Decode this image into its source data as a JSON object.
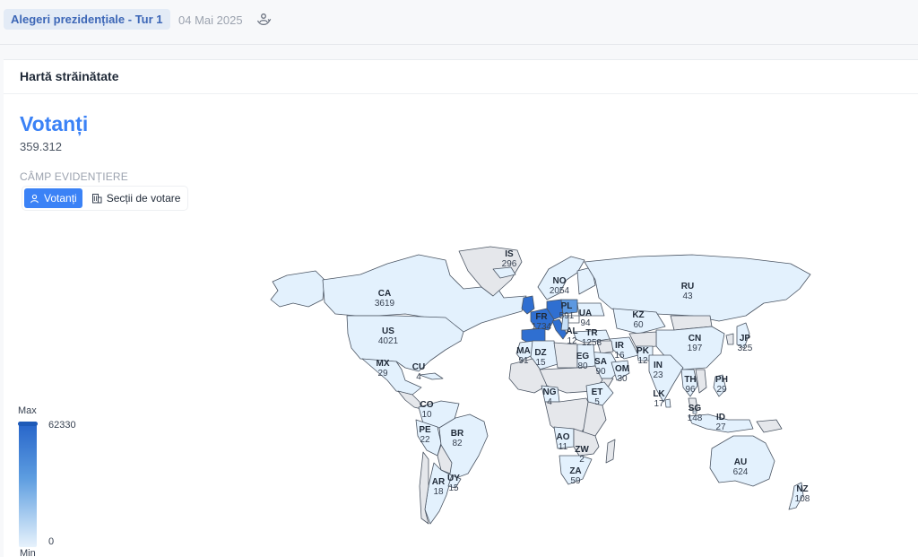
{
  "header": {
    "election": "Alegeri prezidențiale - Tur 1",
    "date": "04 Mai 2025",
    "sync_icon": "sync-people-icon"
  },
  "card": {
    "title": "Hartă străinătate",
    "metric_title": "Votanți",
    "metric_value": "359.312",
    "field_label": "CÂMP EVIDENȚIERE",
    "toggle": {
      "voters_label": "Votanți",
      "voters_icon": "user-icon",
      "stations_label": "Secții de votare",
      "stations_icon": "building-icon",
      "selected": "voters"
    }
  },
  "legend": {
    "max_label": "Max",
    "min_label": "Min",
    "max_value": "62330",
    "min_value": "0",
    "color_max": "#2563c9",
    "color_min": "#e7f2fc"
  },
  "colors": {
    "accent": "#3b82f6",
    "no_data": "#e5e7eb",
    "low": "#e3f1fd"
  },
  "map_labels": [
    {
      "code": "CA",
      "value": "3619"
    },
    {
      "code": "US",
      "value": "4021"
    },
    {
      "code": "MX",
      "value": "29"
    },
    {
      "code": "CU",
      "value": "4"
    },
    {
      "code": "CO",
      "value": "10"
    },
    {
      "code": "PE",
      "value": "22"
    },
    {
      "code": "BR",
      "value": "82"
    },
    {
      "code": "AR",
      "value": "18"
    },
    {
      "code": "UY",
      "value": "15"
    },
    {
      "code": "IS",
      "value": "296"
    },
    {
      "code": "NO",
      "value": "2054"
    },
    {
      "code": "FR",
      "value": "1734"
    },
    {
      "code": "PL",
      "value": "591"
    },
    {
      "code": "UA",
      "value": "94"
    },
    {
      "code": "AL",
      "value": "12"
    },
    {
      "code": "TR",
      "value": "1258"
    },
    {
      "code": "MA",
      "value": "91"
    },
    {
      "code": "DZ",
      "value": "15"
    },
    {
      "code": "EG",
      "value": "80"
    },
    {
      "code": "SA",
      "value": "90"
    },
    {
      "code": "OM",
      "value": "30"
    },
    {
      "code": "IR",
      "value": "16"
    },
    {
      "code": "PK",
      "value": "12"
    },
    {
      "code": "KZ",
      "value": "60"
    },
    {
      "code": "RU",
      "value": "43"
    },
    {
      "code": "CN",
      "value": "197"
    },
    {
      "code": "JP",
      "value": "325"
    },
    {
      "code": "IN",
      "value": "23"
    },
    {
      "code": "LK",
      "value": "17"
    },
    {
      "code": "TH",
      "value": "96"
    },
    {
      "code": "PH",
      "value": "29"
    },
    {
      "code": "SG",
      "value": "148"
    },
    {
      "code": "ID",
      "value": "27"
    },
    {
      "code": "NG",
      "value": "4"
    },
    {
      "code": "ET",
      "value": "5"
    },
    {
      "code": "AO",
      "value": "11"
    },
    {
      "code": "ZW",
      "value": "2"
    },
    {
      "code": "ZA",
      "value": "59"
    },
    {
      "code": "AU",
      "value": "624"
    },
    {
      "code": "NZ",
      "value": "108"
    }
  ]
}
